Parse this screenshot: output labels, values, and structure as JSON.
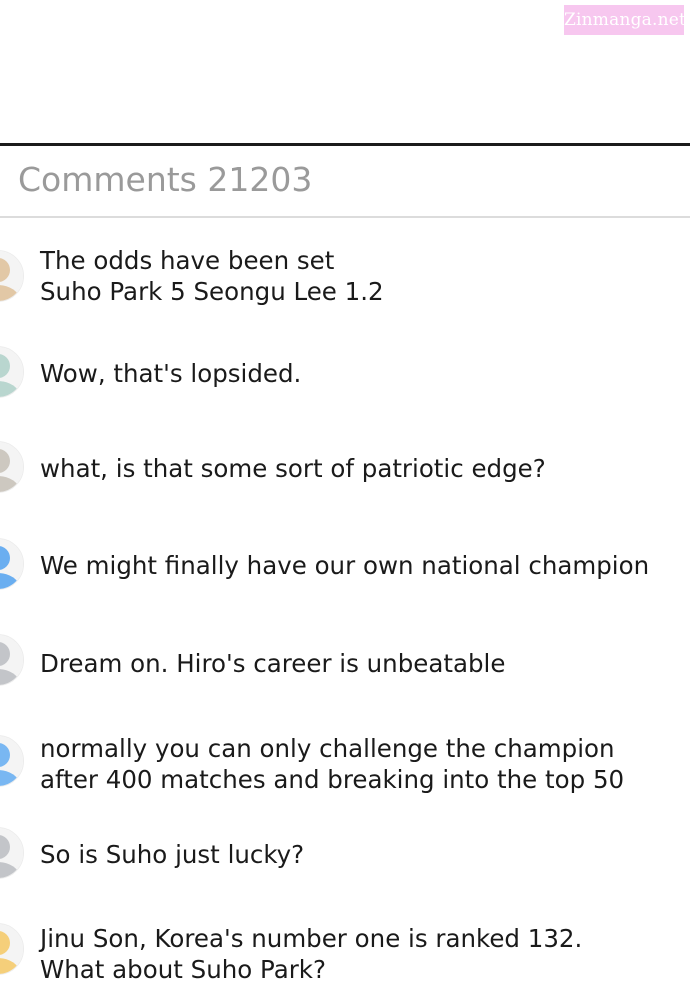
{
  "watermark": "Zinmanga.net",
  "comments_header": "Comments 21203",
  "comments": [
    {
      "lines": [
        "The odds have been set",
        "Suho Park 5 Seongu Lee 1.2"
      ],
      "avatar_color": "#e2c8a6"
    },
    {
      "lines": [
        "Wow, that's lopsided."
      ],
      "avatar_color": "#b9d6cf"
    },
    {
      "lines": [
        "what, is that some sort of patriotic edge?"
      ],
      "avatar_color": "#cdc8c0"
    },
    {
      "lines": [
        "We might finally have our own national champion"
      ],
      "avatar_color": "#6aaef0"
    },
    {
      "lines": [
        "Dream on. Hiro's career is unbeatable"
      ],
      "avatar_color": "#c3c5c9"
    },
    {
      "lines": [
        "normally you can only challenge the champion",
        "after 400 matches and breaking into the top 50"
      ],
      "avatar_color": "#79b7f2"
    },
    {
      "lines": [
        "So is Suho just lucky?"
      ],
      "avatar_color": "#c3c5c9"
    },
    {
      "lines": [
        "Jinu Son, Korea's number one is ranked 132.",
        "What about Suho Park?"
      ],
      "avatar_color": "#f5cf7a"
    }
  ]
}
